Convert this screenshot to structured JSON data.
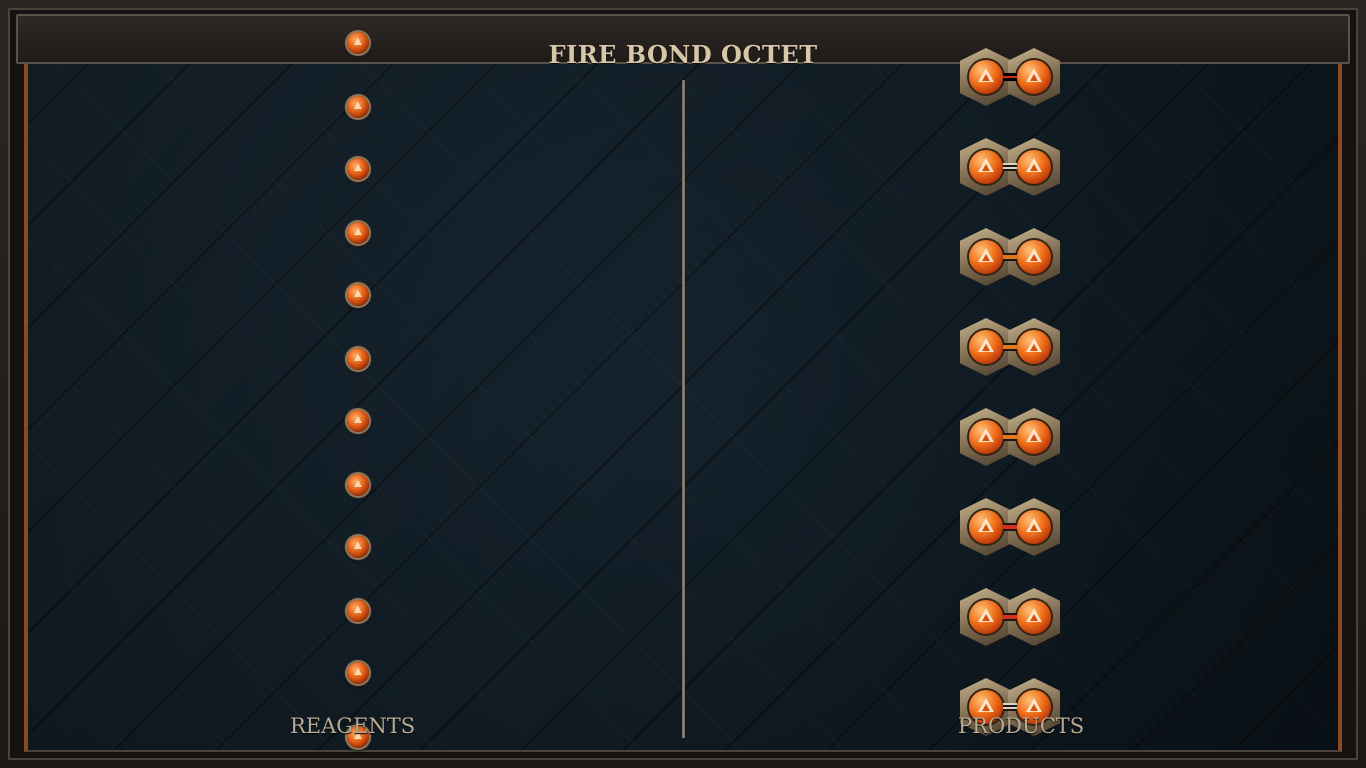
{
  "game": {
    "title": "FIRE BOND OCTET",
    "columns": {
      "reagents_label": "REAGENTS",
      "products_label": "PRODUCTS"
    },
    "reagents": {
      "count": 12,
      "element": "fire",
      "icon": "fire-atom-icon"
    },
    "products": {
      "count": 8,
      "molecule": "fire-fire-pair",
      "bonds": [
        "single",
        "double",
        "orange",
        "orange",
        "orange",
        "red",
        "red",
        "double"
      ]
    },
    "colors": {
      "atom_core": "#f0701a",
      "frame_trim": "#8a4a22",
      "board": "#15222d",
      "title_text": "#d7c6a8"
    }
  }
}
